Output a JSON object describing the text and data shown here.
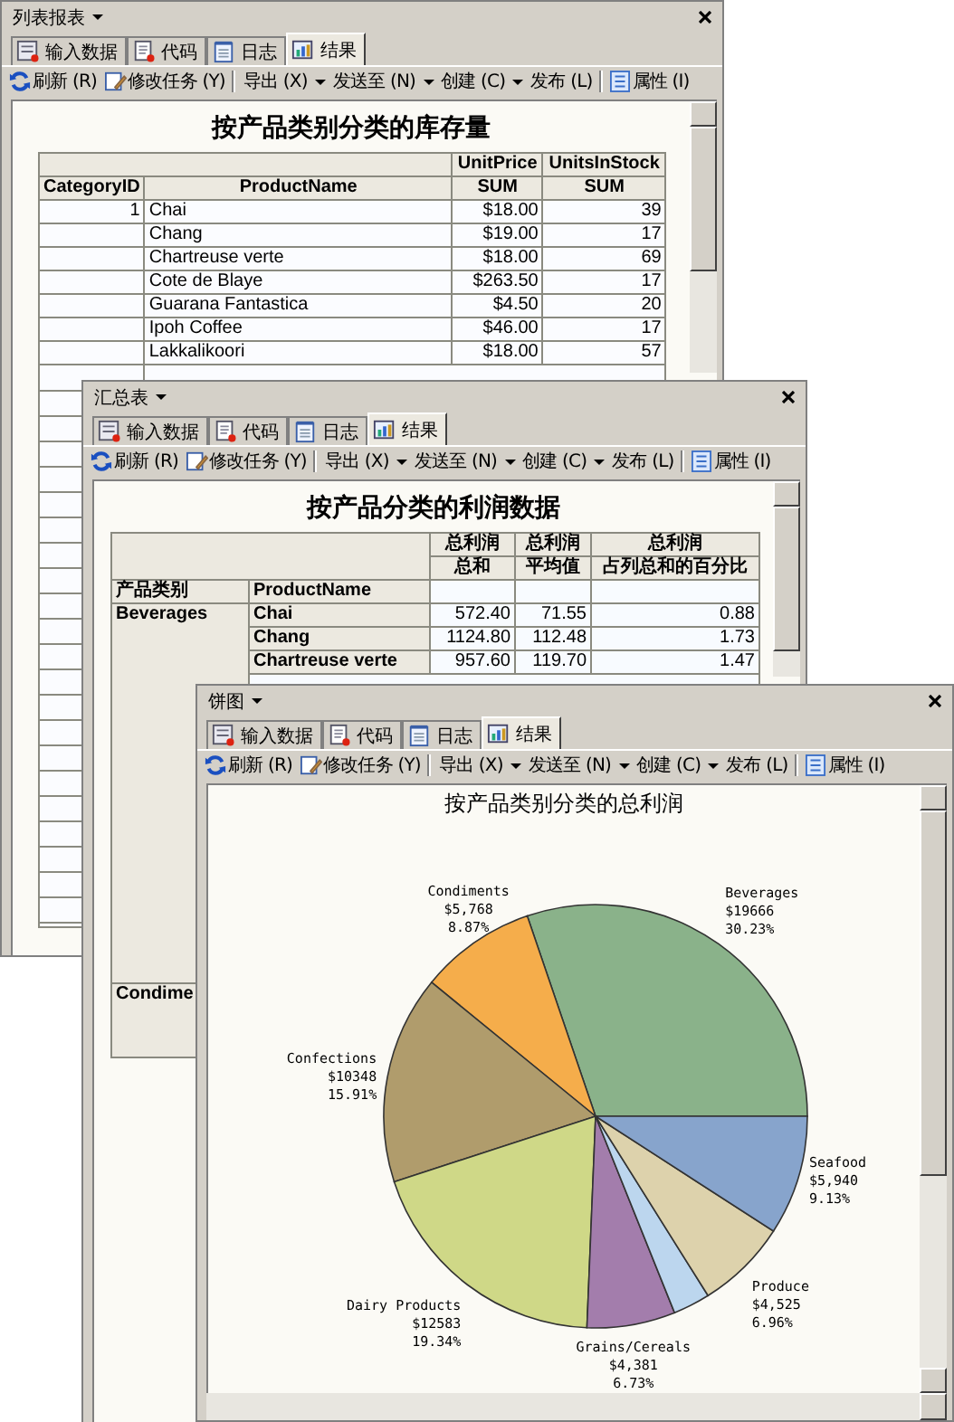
{
  "windows": [
    {
      "title": "列表报表",
      "tabs": [
        {
          "kind": "input",
          "label": "输入数据",
          "selected": false
        },
        {
          "kind": "code",
          "label": "代码",
          "selected": false
        },
        {
          "kind": "log",
          "label": "日志",
          "selected": false
        },
        {
          "kind": "result",
          "label": "结果",
          "selected": true
        }
      ],
      "toolbar": [
        {
          "kind": "refresh",
          "label": "刷新 (R)",
          "separator_before": false
        },
        {
          "kind": "edit",
          "label": "修改任务 (Y)",
          "separator_before": false
        },
        {
          "kind": "menu",
          "label": "导出 (X)",
          "separator_before": true
        },
        {
          "kind": "menu",
          "label": "发送至 (N)",
          "separator_before": false
        },
        {
          "kind": "menu",
          "label": "创建 (C)",
          "separator_before": false
        },
        {
          "kind": "plain",
          "label": "发布 (L)",
          "separator_before": false
        },
        {
          "kind": "properties",
          "label": "属性 (I)",
          "separator_before": true
        }
      ],
      "report": {
        "kind": "list",
        "title": "按产品类别分类的库存量",
        "header_top": [
          "UnitPrice",
          "UnitsInStock"
        ],
        "header": [
          "CategoryID",
          "ProductName",
          "SUM",
          "SUM"
        ],
        "rows": [
          [
            "1",
            "Chai",
            "$18.00",
            "39"
          ],
          [
            null,
            "Chang",
            "$19.00",
            "17"
          ],
          [
            null,
            "Chartreuse verte",
            "$18.00",
            "69"
          ],
          [
            null,
            "Cote de Blaye",
            "$263.50",
            "17"
          ],
          [
            null,
            "Guarana Fantastica",
            "$4.50",
            "20"
          ],
          [
            null,
            "Ipoh Coffee",
            "$46.00",
            "17"
          ],
          [
            null,
            "Lakkalikoori",
            "$18.00",
            "57"
          ]
        ]
      }
    },
    {
      "title": "汇总表",
      "tabs": [
        {
          "kind": "input",
          "label": "输入数据",
          "selected": false
        },
        {
          "kind": "code",
          "label": "代码",
          "selected": false
        },
        {
          "kind": "log",
          "label": "日志",
          "selected": false
        },
        {
          "kind": "result",
          "label": "结果",
          "selected": true
        }
      ],
      "toolbar": [
        {
          "kind": "refresh",
          "label": "刷新 (R)",
          "separator_before": false
        },
        {
          "kind": "edit",
          "label": "修改任务 (Y)",
          "separator_before": false
        },
        {
          "kind": "menu",
          "label": "导出 (X)",
          "separator_before": true
        },
        {
          "kind": "menu",
          "label": "发送至 (N)",
          "separator_before": false
        },
        {
          "kind": "menu",
          "label": "创建 (C)",
          "separator_before": false
        },
        {
          "kind": "plain",
          "label": "发布 (L)",
          "separator_before": false
        },
        {
          "kind": "properties",
          "label": "属性 (I)",
          "separator_before": true
        }
      ],
      "report": {
        "kind": "summary",
        "title": "按产品分类的利润数据",
        "columns": [
          {
            "top": "总利润",
            "bottom": "总和"
          },
          {
            "top": "总利润",
            "bottom": "平均值"
          },
          {
            "top": "总利润",
            "bottom": "占列总和的百分比"
          }
        ],
        "row_headers": [
          "产品类别",
          "ProductName"
        ],
        "groups": [
          {
            "name": "Beverages",
            "rows": [
              {
                "name": "Chai",
                "values": [
                  "572.40",
                  "71.55",
                  "0.88"
                ]
              },
              {
                "name": "Chang",
                "values": [
                  "1124.80",
                  "112.48",
                  "1.73"
                ]
              },
              {
                "name": "Chartreuse verte",
                "values": [
                  "957.60",
                  "119.70",
                  "1.47"
                ]
              }
            ]
          },
          {
            "name": "Condime"
          }
        ]
      }
    },
    {
      "title": "饼图",
      "tabs": [
        {
          "kind": "input",
          "label": "输入数据",
          "selected": false
        },
        {
          "kind": "code",
          "label": "代码",
          "selected": false
        },
        {
          "kind": "log",
          "label": "日志",
          "selected": false
        },
        {
          "kind": "result",
          "label": "结果",
          "selected": true
        }
      ],
      "toolbar": [
        {
          "kind": "refresh",
          "label": "刷新 (R)",
          "separator_before": false
        },
        {
          "kind": "edit",
          "label": "修改任务 (Y)",
          "separator_before": false
        },
        {
          "kind": "menu",
          "label": "导出 (X)",
          "separator_before": true
        },
        {
          "kind": "menu",
          "label": "发送至 (N)",
          "separator_before": false
        },
        {
          "kind": "menu",
          "label": "创建 (C)",
          "separator_before": false
        },
        {
          "kind": "plain",
          "label": "发布 (L)",
          "separator_before": false
        },
        {
          "kind": "properties",
          "label": "属性 (I)",
          "separator_before": true
        }
      ],
      "report": {
        "kind": "pie",
        "chart_data": {
          "type": "pie",
          "title": "按产品类别分类的总利润",
          "categories": [
            "Beverages",
            "Condiments",
            "Confections",
            "Dairy Products",
            "Grains/Cereals",
            null,
            "Produce",
            "Seafood"
          ],
          "colors": [
            "#8ab28a",
            "#f5ad4b",
            "#b09c6c",
            "#cfd887",
            "#a37dac",
            "#bcd6ee",
            "#ddd2ac",
            "#87a4cc"
          ],
          "series": [
            {
              "values": [
                30.23,
                8.87,
                15.91,
                19.34,
                6.73,
                2.83,
                6.96,
                9.13
              ]
            }
          ],
          "value_labels": [
            "$19666\n30.23%",
            "$5,768\n8.87%",
            "$10348\n15.91%",
            "$12583\n19.34%",
            "$4,381\n6.73%",
            null,
            "$4,525\n6.96%",
            "$5,940\n9.13%"
          ]
        }
      }
    }
  ]
}
